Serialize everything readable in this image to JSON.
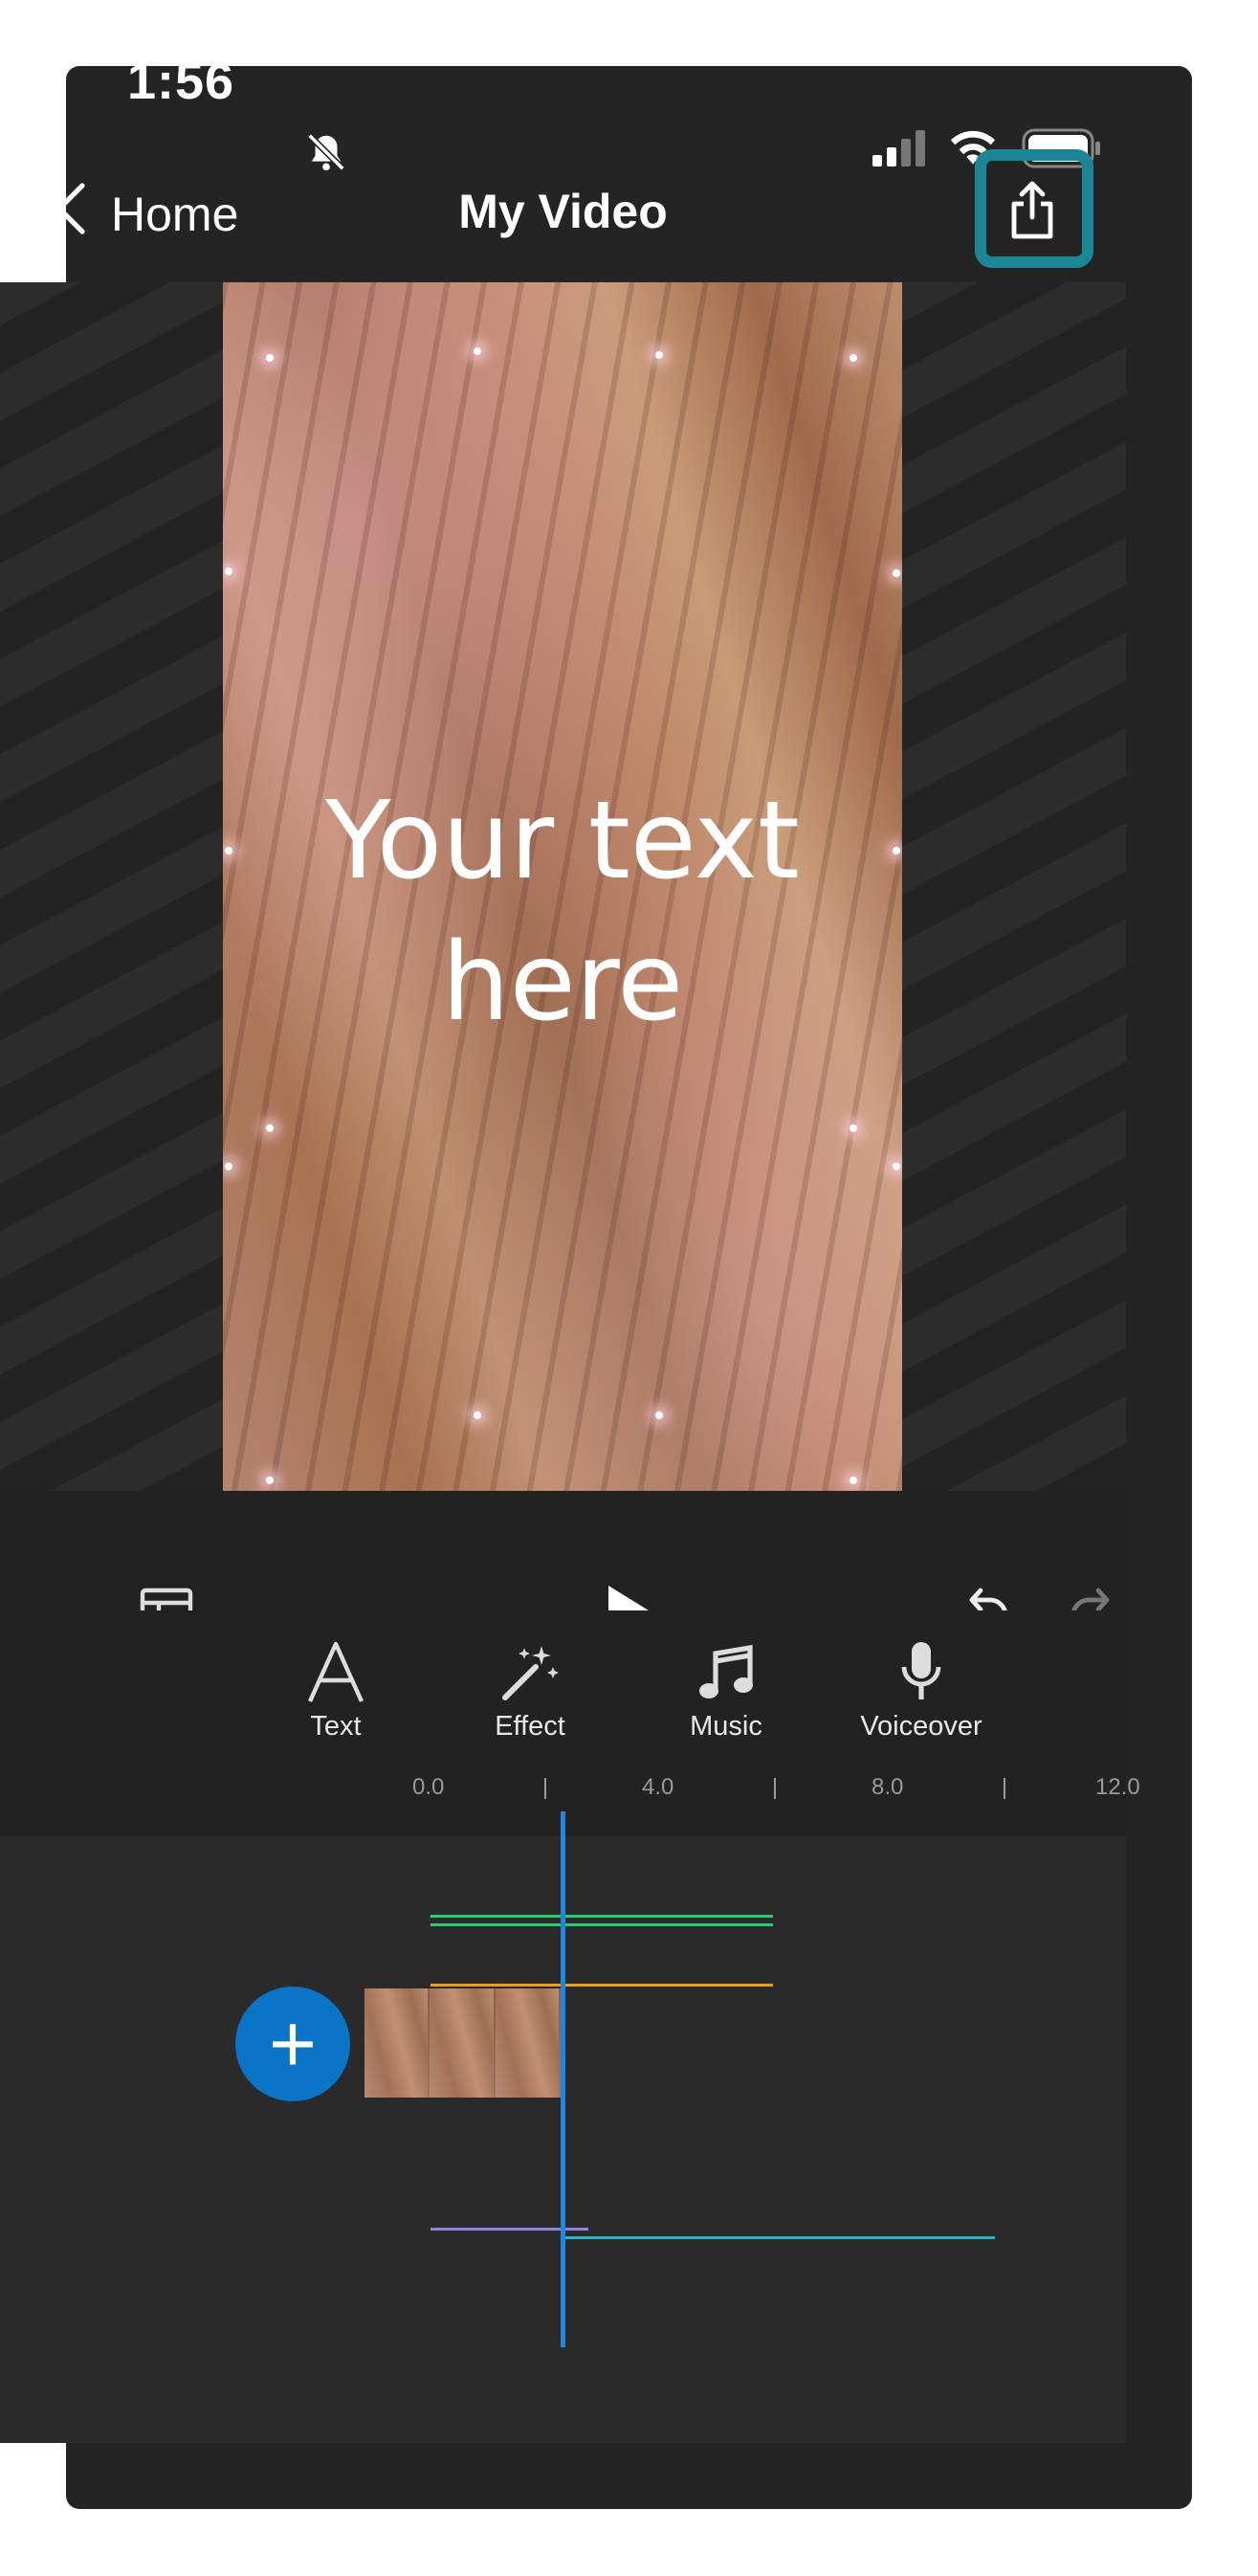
{
  "status_bar": {
    "time": "1:56"
  },
  "nav": {
    "back_label": "Home",
    "title": "My Video"
  },
  "preview": {
    "overlay_text_line1": "Your text",
    "overlay_text_line2": "here"
  },
  "tools": [
    {
      "label": "Text",
      "icon": "text-icon"
    },
    {
      "label": "Effect",
      "icon": "magic-wand-icon"
    },
    {
      "label": "Music",
      "icon": "music-note-icon"
    },
    {
      "label": "Voiceover",
      "icon": "microphone-icon"
    }
  ],
  "ruler": [
    "0.0",
    "4.0",
    "8.0",
    "12.0"
  ],
  "colors": {
    "highlight": "#1b8696",
    "playhead": "#1d87e5",
    "add_button": "#0a74c6",
    "track_text": "#2ecc71",
    "track_effect": "#f39c12",
    "track_music": "#8e86d8",
    "track_voiceover": "#26b5c4"
  }
}
